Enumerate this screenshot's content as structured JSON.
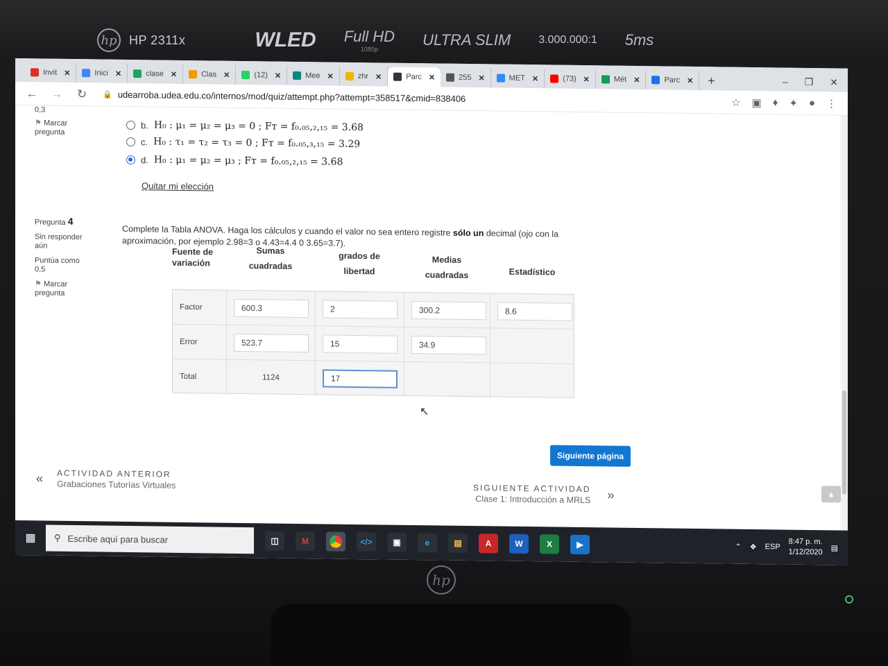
{
  "monitor": {
    "model": "HP 2311x",
    "tech": "WLED",
    "resolution": "Full HD",
    "resolution_sub": "1080p",
    "style": "ULTRA SLIM",
    "contrast": "3.000.000:1",
    "response": "5ms"
  },
  "tabs": [
    {
      "label": "Invit",
      "color": "#d93025"
    },
    {
      "label": "Inici",
      "color": "#4285f4"
    },
    {
      "label": "clase",
      "color": "#1fa463"
    },
    {
      "label": "Clas",
      "color": "#f29900"
    },
    {
      "label": "(12)",
      "color": "#25d366"
    },
    {
      "label": "Mee",
      "color": "#00897b"
    },
    {
      "label": "zhr",
      "color": "#f4b400"
    },
    {
      "label": "Parc",
      "color": "#333333",
      "active": true
    },
    {
      "label": "255",
      "color": "#555555"
    },
    {
      "label": "MET",
      "color": "#2d8cff"
    },
    {
      "label": "(73)",
      "color": "#ff0000"
    },
    {
      "label": "Mét",
      "color": "#0f9d58"
    },
    {
      "label": "Parc",
      "color": "#1a73e8"
    }
  ],
  "url": "udearroba.udea.edu.co/internos/mod/quiz/attempt.php?attempt=358517&cmid=838406",
  "prev_question": {
    "status_top": "0,3",
    "flag": "Marcar pregunta",
    "options": [
      {
        "letter": "b.",
        "formula": "H₀ : μ₁ = μ₂ = μ₃ = 0 ; Fᴛ = f₀.₀₅,₂,₁₅ = 3.68",
        "checked": false
      },
      {
        "letter": "c.",
        "formula": "H₀ : τ₁ = τ₂ = τ₃ = 0 ; Fᴛ = f₀.₀₅,₃,₁₅ = 3.29",
        "checked": false
      },
      {
        "letter": "d.",
        "formula": "H₀ : μ₁ = μ₂ = μ₃ ; Fᴛ = f₀.₀₅,₂,₁₅ = 3.68",
        "checked": true
      }
    ],
    "clear": "Quitar mi elección"
  },
  "question4": {
    "label": "Pregunta",
    "number": "4",
    "status": "Sin responder aún",
    "score": "Puntúa como 0,5",
    "flag": "Marcar pregunta",
    "text_before": "Complete la Tabla ANOVA. Haga los cálculos y cuando el valor no sea entero  registre ",
    "text_bold": "sólo un",
    "text_after": " decimal (ojo con la aproximación, por ejemplo 2.98=3 o 4.43=4.4 0 3.65=3.7).",
    "headers": {
      "source_1": "Fuente de",
      "source_2": "variación",
      "sums_1": "Sumas",
      "sums_2": "cuadradas",
      "df_1": "grados de",
      "df_2": "libertad",
      "means_1": "Medias",
      "means_2": "cuadradas",
      "stat": "Estadístico"
    },
    "rows": {
      "factor": {
        "label": "Factor",
        "ss": "600.3",
        "df": "2",
        "ms": "300.2",
        "f": "8.6"
      },
      "error": {
        "label": "Error",
        "ss": "523.7",
        "df": "15",
        "ms": "34.9"
      },
      "total": {
        "label": "Total",
        "ss": "1124",
        "df": "17"
      }
    }
  },
  "next_page_button": "Siguiente página",
  "prev_activity": {
    "title": "ACTIVIDAD ANTERIOR",
    "name": "Grabaciones Tutorías Virtuales"
  },
  "next_activity": {
    "title": "SIGUIENTE ACTIVIDAD",
    "name": "Clase 1: Introducción a MRLS"
  },
  "taskbar": {
    "search_placeholder": "Escribe aquí para buscar",
    "lang": "ESP",
    "time": "8:47 p. m.",
    "date": "1/12/2020"
  }
}
